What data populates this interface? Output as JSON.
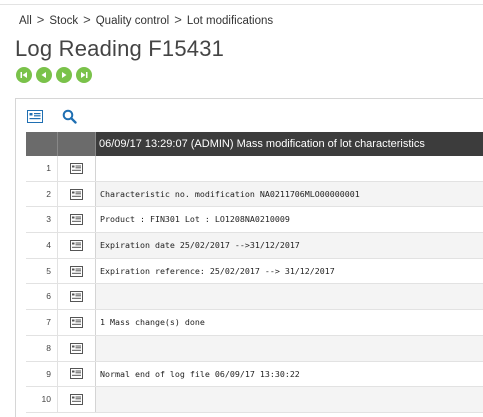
{
  "breadcrumb": {
    "items": [
      "All",
      "Stock",
      "Quality control",
      "Lot modifications"
    ],
    "separator": ">"
  },
  "page": {
    "title": "Log Reading F15431"
  },
  "navigation": {
    "buttons": [
      "first-record-icon",
      "previous-record-icon",
      "next-record-icon",
      "last-record-icon"
    ],
    "color": "#7ac24a"
  },
  "toolbar": {
    "icons": [
      "detail-view-icon",
      "search-icon"
    ],
    "accent": "#1f6fb2"
  },
  "grid": {
    "header_message": "06/09/17 13:29:07 (ADMIN) Mass modification of lot characteristics",
    "header_color": "#3c3c3c",
    "row_icon": "row-detail-icon",
    "rows": [
      {
        "num": "1",
        "text": ""
      },
      {
        "num": "2",
        "text": "Characteristic no. modification NA0211706MLO00000001"
      },
      {
        "num": "3",
        "text": "Product : FIN301 Lot : LO1208NA0210009"
      },
      {
        "num": "4",
        "text": "Expiration date 25/02/2017 -->31/12/2017"
      },
      {
        "num": "5",
        "text": "Expiration reference: 25/02/2017 --> 31/12/2017"
      },
      {
        "num": "6",
        "text": ""
      },
      {
        "num": "7",
        "text": "1 Mass change(s) done"
      },
      {
        "num": "8",
        "text": ""
      },
      {
        "num": "9",
        "text": "Normal end of log file 06/09/17 13:30:22"
      },
      {
        "num": "10",
        "text": ""
      }
    ]
  }
}
